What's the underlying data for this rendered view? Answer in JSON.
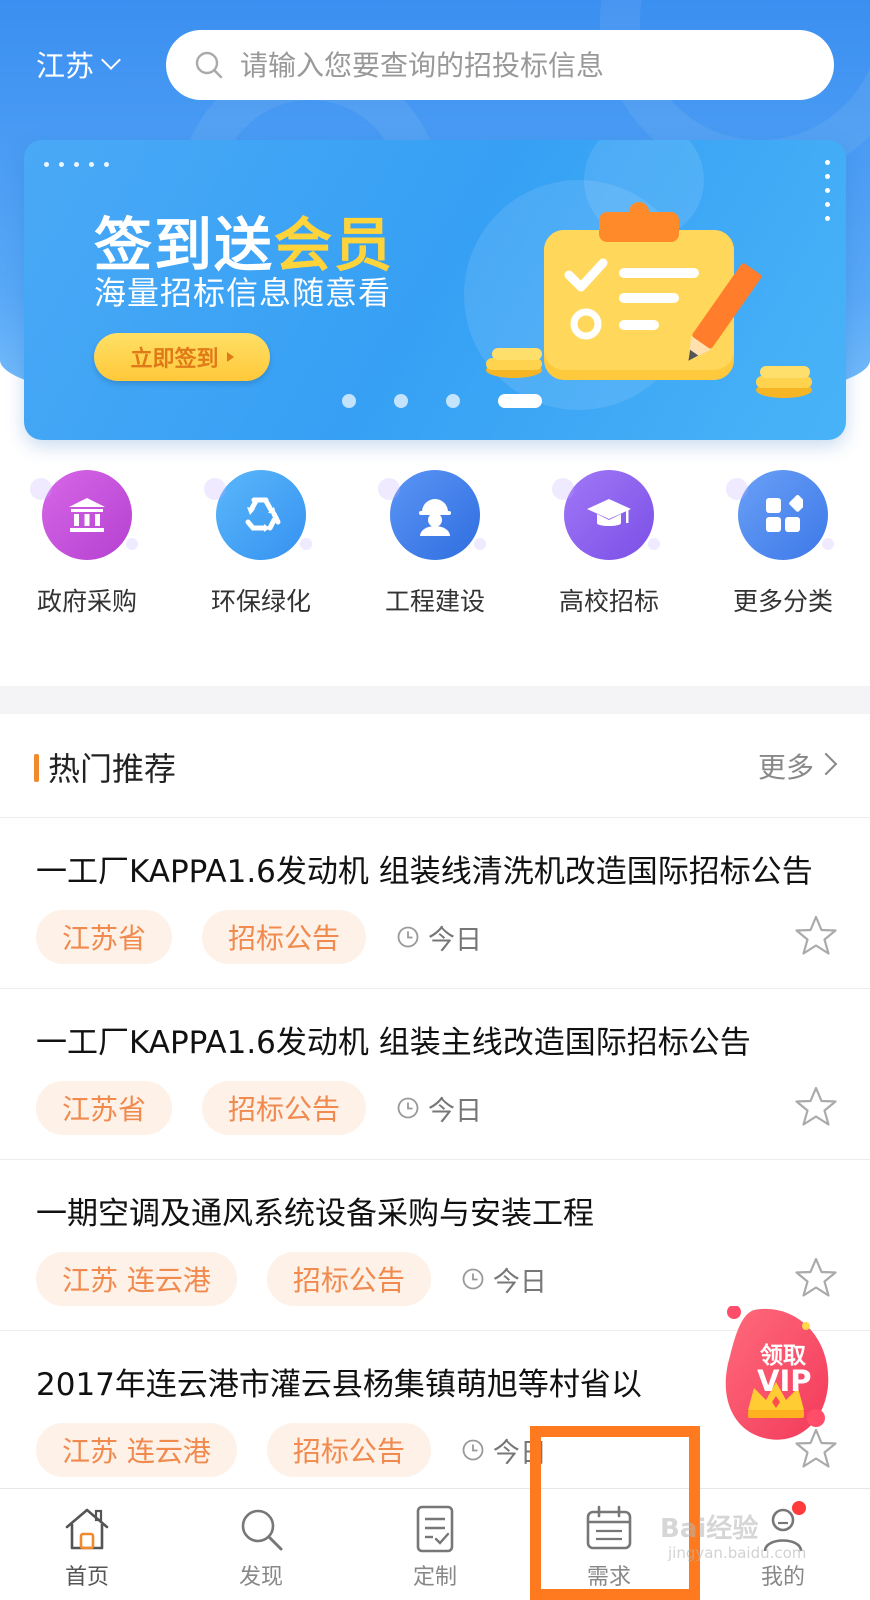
{
  "header": {
    "region": "江苏",
    "search_placeholder": "请输入您要查询的招投标信息"
  },
  "banner": {
    "title_part1": "签到送",
    "title_part2": "会员",
    "subtitle": "海量招标信息随意看",
    "button_label": "立即签到",
    "page_count": 4,
    "active_page": 4
  },
  "categories": [
    {
      "label": "政府采购",
      "icon": "government-building-icon",
      "color": "#c44fd8"
    },
    {
      "label": "环保绿化",
      "icon": "recycle-icon",
      "color": "#3f9df3"
    },
    {
      "label": "工程建设",
      "icon": "construction-worker-icon",
      "color": "#3f7ee8"
    },
    {
      "label": "高校招标",
      "icon": "graduation-cap-icon",
      "color": "#8a5ff0"
    },
    {
      "label": "更多分类",
      "icon": "grid-more-icon",
      "color": "#4a86f0"
    }
  ],
  "hot": {
    "title": "热门推荐",
    "more_label": "更多"
  },
  "items": [
    {
      "title": "一工厂KAPPA1.6发动机 组装线清洗机改造国际招标公告",
      "region": "江苏省",
      "type": "招标公告",
      "date": "今日"
    },
    {
      "title": "一工厂KAPPA1.6发动机 组装主线改造国际招标公告",
      "region": "江苏省",
      "type": "招标公告",
      "date": "今日"
    },
    {
      "title": "一期空调及通风系统设备采购与安装工程",
      "region": "江苏 连云港",
      "type": "招标公告",
      "date": "今日"
    },
    {
      "title": "2017年连云港市灌云县杨集镇萌旭等村省以",
      "region": "江苏 连云港",
      "type": "招标公告",
      "date": "今日"
    }
  ],
  "vip": {
    "line1": "领取",
    "line2": "VIP"
  },
  "tabs": [
    {
      "label": "首页",
      "icon": "home-icon"
    },
    {
      "label": "发现",
      "icon": "search-icon"
    },
    {
      "label": "定制",
      "icon": "checklist-icon"
    },
    {
      "label": "需求",
      "icon": "calendar-icon"
    },
    {
      "label": "我的",
      "icon": "user-icon"
    }
  ],
  "watermark": {
    "main": "Bai经验",
    "sub": "jingyan.baidu.com"
  },
  "colors": {
    "primary": "#3b8ff0",
    "accent_orange": "#f08a2c",
    "tag_text": "#f08a4e",
    "tag_bg": "#fdf1e8",
    "highlight_box": "#ff7a1e"
  }
}
